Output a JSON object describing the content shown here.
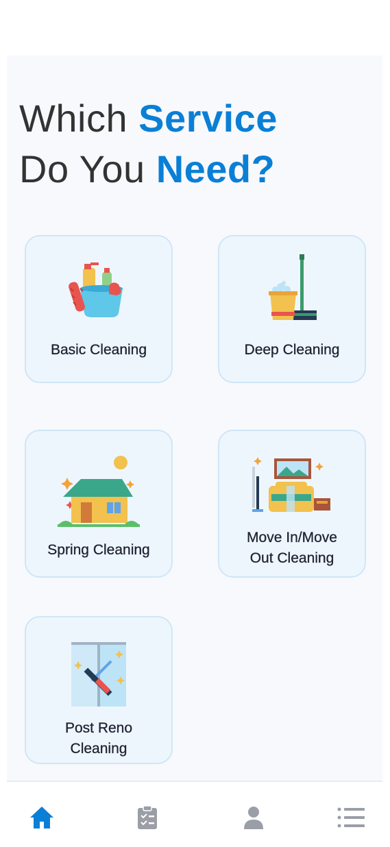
{
  "header": {
    "line1_plain": "Which ",
    "line1_accent": "Service",
    "line2_plain": "Do You ",
    "line2_accent": "Need?"
  },
  "colors": {
    "accent": "#0a7fd6",
    "heading": "#333333",
    "card_bg": "#eef6fd",
    "card_border": "#cfe6f7",
    "nav_active": "#0a7fd6",
    "nav_inactive": "#9a9ea6"
  },
  "services": [
    {
      "id": "basic",
      "label": "Basic Cleaning",
      "icon": "cleaning-supplies-bucket-icon"
    },
    {
      "id": "deep",
      "label": "Deep Cleaning",
      "icon": "mop-bucket-icon"
    },
    {
      "id": "spring",
      "label": "Spring Cleaning",
      "icon": "house-sparkle-icon"
    },
    {
      "id": "move",
      "label_line1": "Move In/Move",
      "label_line2": "Out Cleaning",
      "icon": "furnished-room-icon"
    },
    {
      "id": "postreno",
      "label_line1": "Post Reno",
      "label_line2": "Cleaning",
      "icon": "window-squeegee-icon"
    }
  ],
  "bottom_nav": [
    {
      "name": "home",
      "icon": "home-icon",
      "active": true
    },
    {
      "name": "bookings",
      "icon": "clipboard-checklist-icon",
      "active": false
    },
    {
      "name": "profile",
      "icon": "user-icon",
      "active": false
    },
    {
      "name": "menu",
      "icon": "list-menu-icon",
      "active": false
    }
  ]
}
